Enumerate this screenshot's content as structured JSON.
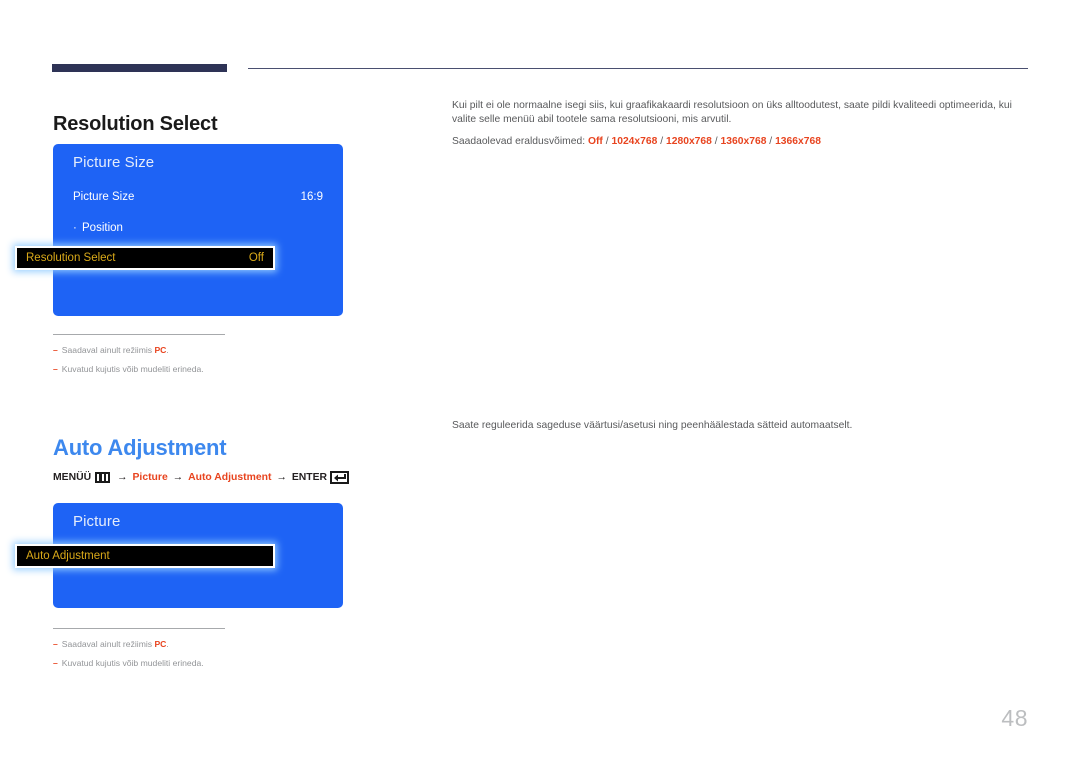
{
  "page": {
    "number": "48"
  },
  "sections": [
    {
      "title": "Resolution Select",
      "description_p1": "Kui pilt ei ole normaalne isegi siis, kui graafikakaardi resolutsioon on üks alltoodutest, saate pildi kvaliteedi optimeerida, kui valite selle menüü abil tootele sama resolutsiooni, mis arvutil.",
      "description_p2_prefix": "Saadaolevad eraldusvõimed: ",
      "options": [
        "Off",
        "1024x768",
        "1280x768",
        "1360x768",
        "1366x768"
      ],
      "option_separator": " / ",
      "osd": {
        "title": "Picture Size",
        "rows": [
          {
            "label": "Picture Size",
            "value": "16:9",
            "bullet": false,
            "selected": false
          },
          {
            "label": "Position",
            "value": "",
            "bullet": true,
            "selected": false
          },
          {
            "label": "Resolution Select",
            "value": "Off",
            "bullet": false,
            "selected": true
          }
        ]
      },
      "notes": [
        {
          "text_before": "Saadaval ainult režiimis ",
          "emphasis": "PC",
          "text_after": "."
        },
        {
          "text_before": "Kuvatud kujutis võib mudeliti erineda.",
          "emphasis": "",
          "text_after": ""
        }
      ]
    },
    {
      "title": "Auto Adjustment",
      "description_p1": "Saate reguleerida sageduse väärtusi/asetusi ning peenhäälestada sätteid automaatselt.",
      "menu_path": {
        "menu_label": "MENÜÜ",
        "menu_icon": "menu-grid-icon",
        "step1": "Picture",
        "step2": "Auto Adjustment",
        "enter_label": "ENTER",
        "enter_icon": "enter-return-icon",
        "arrow": "→"
      },
      "osd": {
        "title": "Picture",
        "scroll_up_icon": "chevron-up-icon",
        "scroll_down_icon": "chevron-down-icon",
        "rows": [
          {
            "label": "Auto Adjustment",
            "value": "",
            "bullet": false,
            "selected": true
          }
        ]
      },
      "notes": [
        {
          "text_before": "Saadaval ainult režiimis ",
          "emphasis": "PC",
          "text_after": "."
        },
        {
          "text_before": "Kuvatud kujutis võib mudeliti erineda.",
          "emphasis": "",
          "text_after": ""
        }
      ]
    }
  ],
  "colors": {
    "osd_blue": "#1e63f5",
    "accent_red": "#e8441f",
    "heading_blue": "#3d88ee",
    "highlight_text": "#d9a919",
    "rule_navy": "#2e3356",
    "note_gray": "#939598",
    "page_number_gray": "#bcbec0"
  },
  "symbols": {
    "bullet": "·",
    "dash": "–"
  }
}
